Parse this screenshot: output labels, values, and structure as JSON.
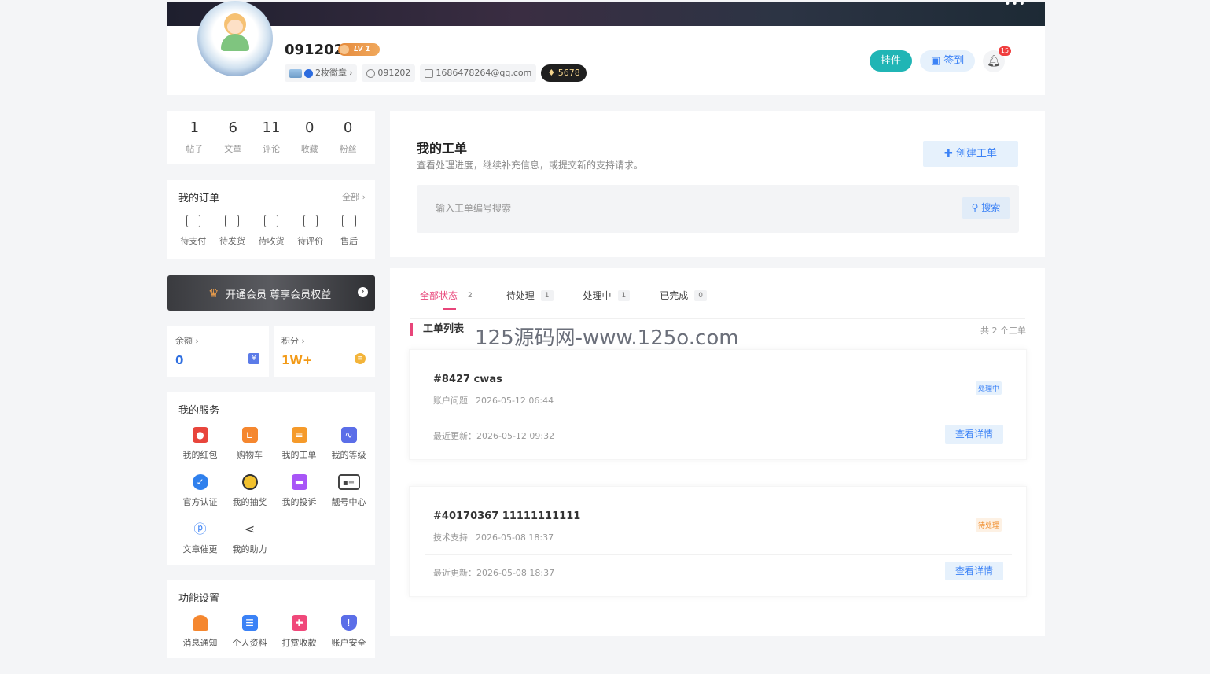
{
  "profile": {
    "username": "091202",
    "level": "LV 1",
    "medals": "2枚徽章",
    "user_id": "091202",
    "email": "1686478264@qq.com",
    "points_badge": "♦ 5678",
    "pendant_button": "挂件",
    "signin_button": "签到",
    "notification_count": "15"
  },
  "stats": [
    {
      "value": "1",
      "label": "帖子"
    },
    {
      "value": "6",
      "label": "文章"
    },
    {
      "value": "11",
      "label": "评论"
    },
    {
      "value": "0",
      "label": "收藏"
    },
    {
      "value": "0",
      "label": "粉丝"
    }
  ],
  "orders": {
    "title": "我的订单",
    "more": "全部 ›",
    "items": [
      {
        "label": "待支付",
        "icon": "wallet-icon"
      },
      {
        "label": "待发货",
        "icon": "package-icon"
      },
      {
        "label": "待收货",
        "icon": "truck-icon"
      },
      {
        "label": "待评价",
        "icon": "comment-icon"
      },
      {
        "label": "售后",
        "icon": "after-sales-icon"
      }
    ]
  },
  "vip": {
    "text": "开通会员 尊享会员权益"
  },
  "wallet": {
    "balance_title": "余额 ›",
    "balance_value": "0",
    "points_title": "积分 ›",
    "points_value": "1W+"
  },
  "services": {
    "title": "我的服务",
    "items": [
      {
        "label": "我的红包",
        "icon": "red-packet-icon",
        "color": "#e8453c"
      },
      {
        "label": "购物车",
        "icon": "cart-icon",
        "color": "#f5872f"
      },
      {
        "label": "我的工单",
        "icon": "ticket-icon",
        "color": "#f59a2a"
      },
      {
        "label": "我的等级",
        "icon": "level-icon",
        "color": "#5b6ee8"
      },
      {
        "label": "官方认证",
        "icon": "verified-icon",
        "color": "#2f80ed"
      },
      {
        "label": "我的抽奖",
        "icon": "lottery-icon",
        "color": "#f2c12e"
      },
      {
        "label": "我的投诉",
        "icon": "complaint-icon",
        "color": "#a855f7"
      },
      {
        "label": "靓号中心",
        "icon": "id-card-icon",
        "color": "#444444"
      },
      {
        "label": "文章催更",
        "icon": "fingerprint-icon",
        "color": "#3b82f6"
      },
      {
        "label": "我的助力",
        "icon": "share-icon",
        "color": "#444444"
      }
    ]
  },
  "settings": {
    "title": "功能设置",
    "items": [
      {
        "label": "消息通知",
        "icon": "bell-icon",
        "color": "#f5872f"
      },
      {
        "label": "个人资料",
        "icon": "profile-icon",
        "color": "#3b82f6"
      },
      {
        "label": "打赏收款",
        "icon": "gift-icon",
        "color": "#f0487a"
      },
      {
        "label": "账户安全",
        "icon": "shield-icon",
        "color": "#5b6ee8"
      }
    ]
  },
  "tickets": {
    "title": "我的工单",
    "subtitle": "查看处理进度，继续补充信息，或提交新的支持请求。",
    "create_button": "✚ 创建工单",
    "search_placeholder": "输入工单编号搜索",
    "search_button": "搜索",
    "tabs": [
      {
        "label": "全部状态",
        "count": "2"
      },
      {
        "label": "待处理",
        "count": "1"
      },
      {
        "label": "处理中",
        "count": "1"
      },
      {
        "label": "已完成",
        "count": "0"
      }
    ],
    "list_title": "工单列表",
    "list_count": "共 2 个工单",
    "watermark": "125源码网-www.125o.com",
    "items": [
      {
        "title": "#8427 cwas",
        "category": "账户问题",
        "created": "2026-05-12 06:44",
        "status": "处理中",
        "status_color": "#3b82f6",
        "status_bg": "#e6f1fc",
        "updated": "最近更新：2026-05-12 09:32",
        "detail_button": "查看详情"
      },
      {
        "title": "#40170367 11111111111",
        "category": "技术支持",
        "created": "2026-05-08 18:37",
        "status": "待处理",
        "status_color": "#f08c2a",
        "status_bg": "#fdf1e4",
        "updated": "最近更新：2026-05-08 18:37",
        "detail_button": "查看详情"
      }
    ]
  }
}
